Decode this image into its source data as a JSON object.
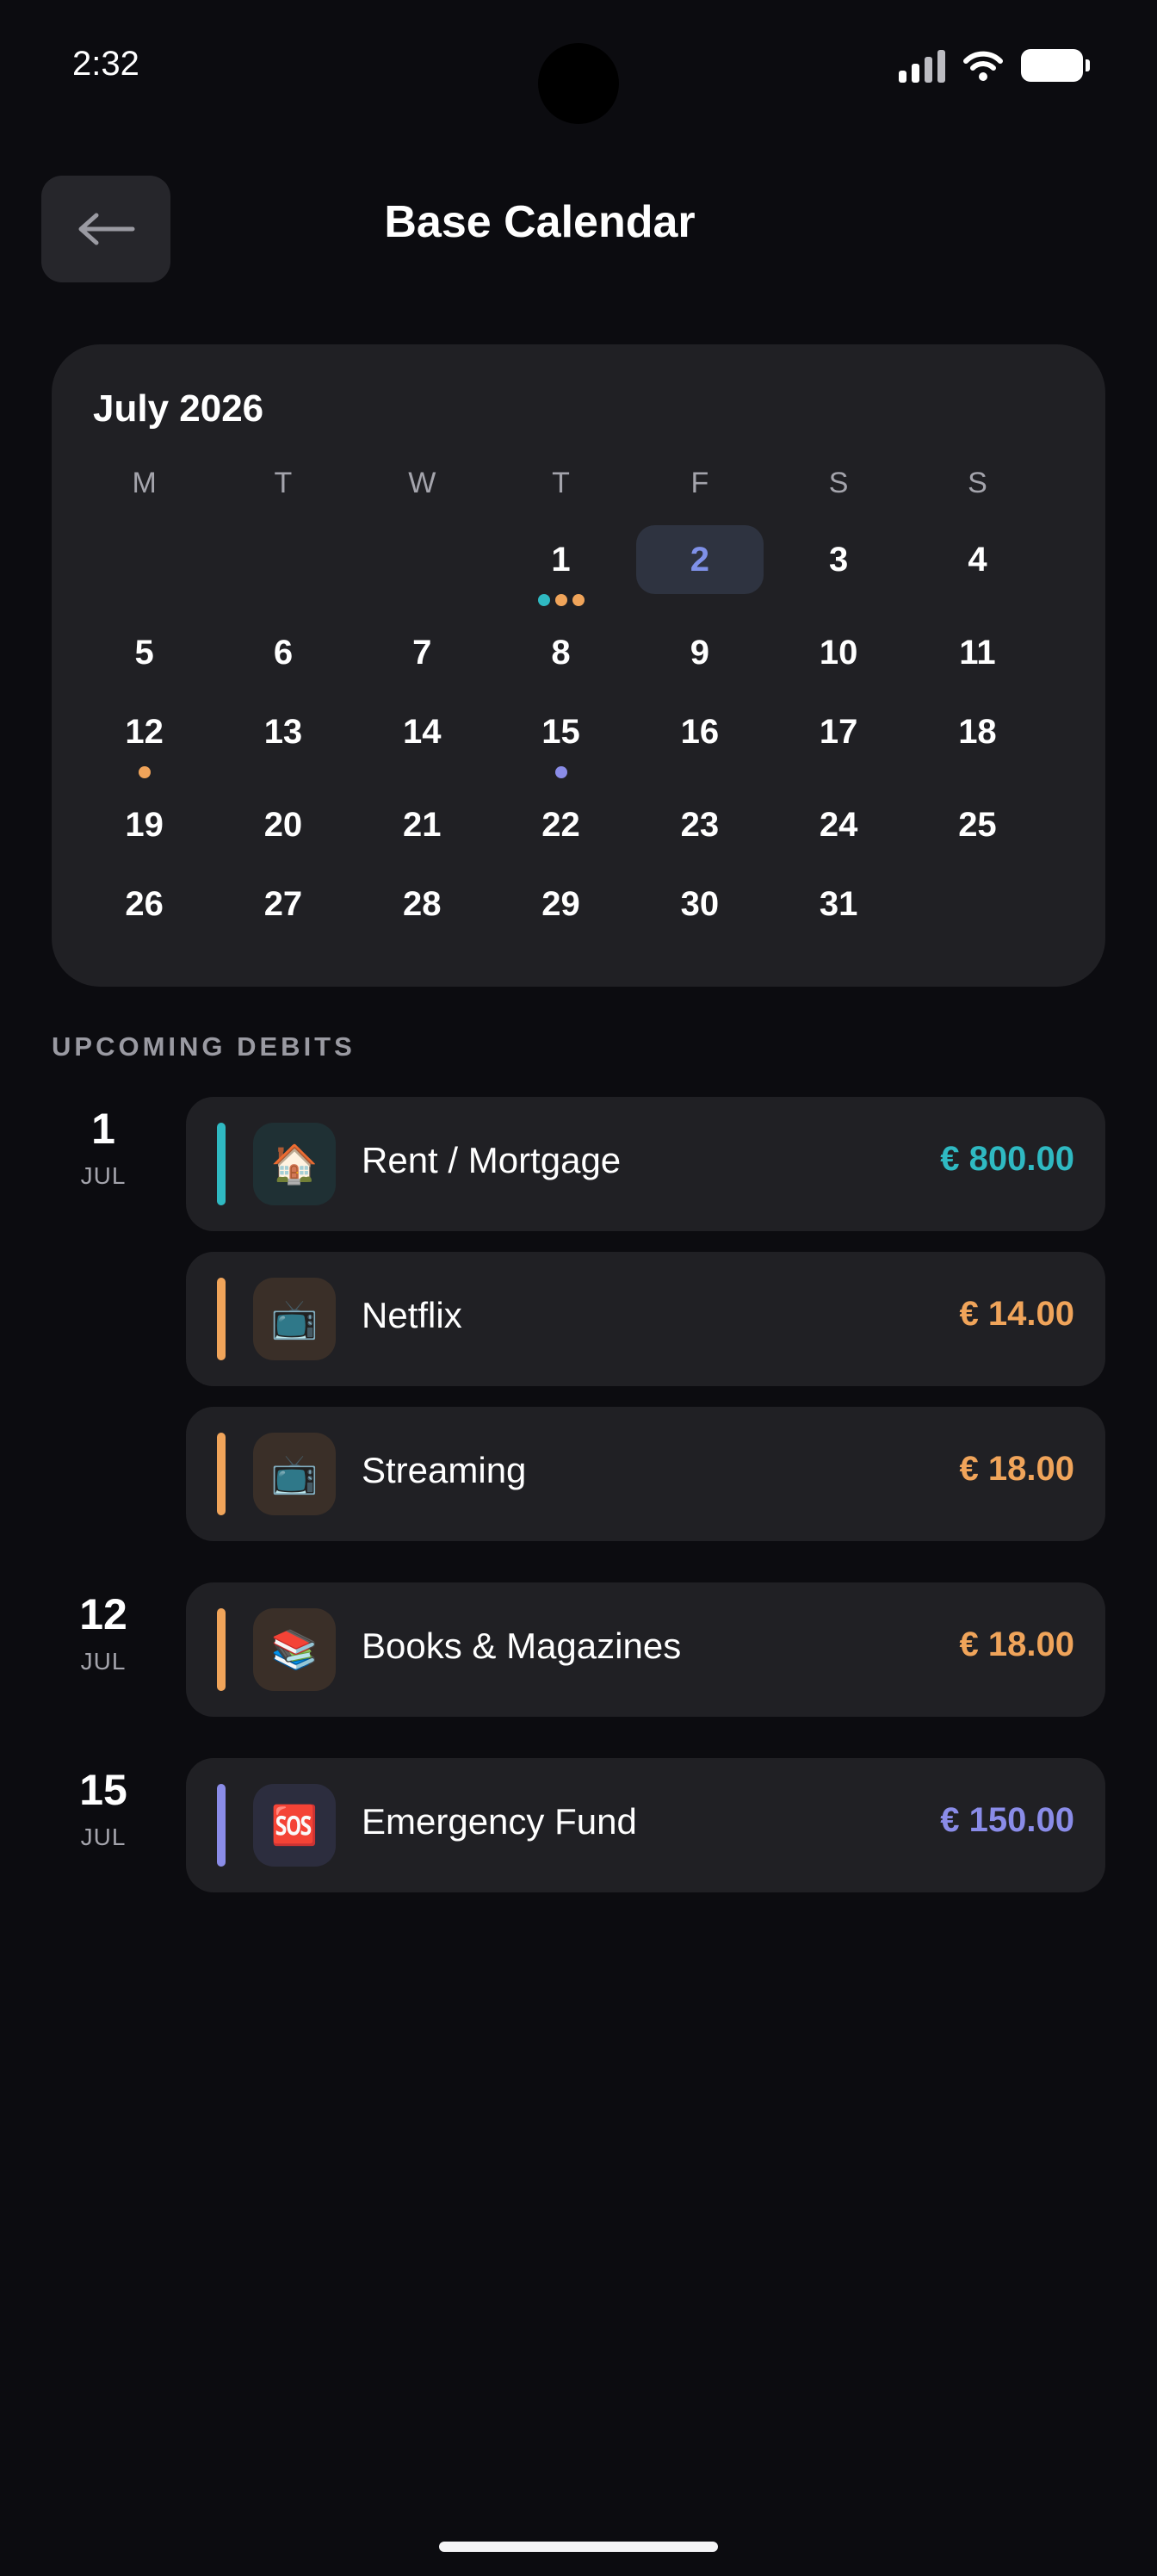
{
  "status_bar": {
    "time": "2:32"
  },
  "header": {
    "title": "Base Calendar",
    "back_icon": "arrow-left-icon"
  },
  "calendar": {
    "month_label": "July 2026",
    "weekdays": [
      "M",
      "T",
      "W",
      "T",
      "F",
      "S",
      "S"
    ],
    "selected_day": "2",
    "weeks": [
      [
        null,
        null,
        null,
        {
          "day": "1",
          "dots": [
            "#2fb9c2",
            "#f0a45a",
            "#f0a45a"
          ]
        },
        {
          "day": "2"
        },
        {
          "day": "3"
        },
        {
          "day": "4"
        }
      ],
      [
        {
          "day": "5"
        },
        {
          "day": "6"
        },
        {
          "day": "7"
        },
        {
          "day": "8"
        },
        {
          "day": "9"
        },
        {
          "day": "10"
        },
        {
          "day": "11"
        }
      ],
      [
        {
          "day": "12",
          "dots": [
            "#f0a45a"
          ]
        },
        {
          "day": "13"
        },
        {
          "day": "14"
        },
        {
          "day": "15",
          "dots": [
            "#8a8ce8"
          ]
        },
        {
          "day": "16"
        },
        {
          "day": "17"
        },
        {
          "day": "18"
        }
      ],
      [
        {
          "day": "19"
        },
        {
          "day": "20"
        },
        {
          "day": "21"
        },
        {
          "day": "22"
        },
        {
          "day": "23"
        },
        {
          "day": "24"
        },
        {
          "day": "25"
        }
      ],
      [
        {
          "day": "26"
        },
        {
          "day": "27"
        },
        {
          "day": "28"
        },
        {
          "day": "29"
        },
        {
          "day": "30"
        },
        {
          "day": "31"
        },
        null
      ]
    ]
  },
  "upcoming": {
    "section_label": "UPCOMING DEBITS",
    "groups": [
      {
        "day": "1",
        "month": "JUL"
      },
      {
        "day": "12",
        "month": "JUL"
      },
      {
        "day": "15",
        "month": "JUL"
      }
    ],
    "items": [
      {
        "name": "Rent / Mortgage",
        "amount": "€ 800.00",
        "icon": "🏠",
        "icon_name": "house-icon",
        "color": "#2fb9c2",
        "icon_bg": "#1f3034"
      },
      {
        "name": "Netflix",
        "amount": "€ 14.00",
        "icon": "📺",
        "icon_name": "tv-icon",
        "color": "#f0a45a",
        "icon_bg": "#3a2f28"
      },
      {
        "name": "Streaming",
        "amount": "€ 18.00",
        "icon": "📺",
        "icon_name": "tv-icon",
        "color": "#f0a45a",
        "icon_bg": "#3a2f28"
      },
      {
        "name": "Books & Magazines",
        "amount": "€ 18.00",
        "icon": "📚",
        "icon_name": "books-icon",
        "color": "#f0a45a",
        "icon_bg": "#3a2f28"
      },
      {
        "name": "Emergency Fund",
        "amount": "€ 150.00",
        "icon": "🆘",
        "icon_name": "sos-icon",
        "color": "#8a8ce8",
        "icon_bg": "#2c2d3e"
      }
    ]
  }
}
